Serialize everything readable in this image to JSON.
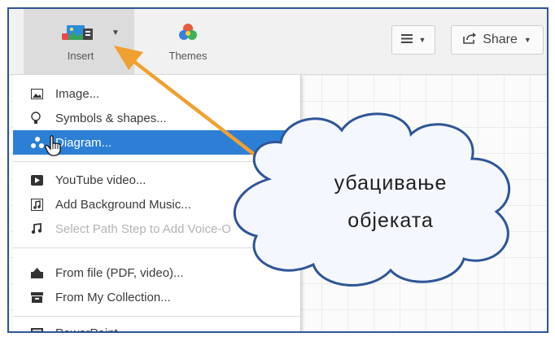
{
  "toolbar": {
    "insert_label": "Insert",
    "themes_label": "Themes",
    "share_label": "Share"
  },
  "menu": {
    "image": "Image...",
    "symbols": "Symbols & shapes...",
    "diagram": "Diagram...",
    "youtube": "YouTube video...",
    "music": "Add Background Music...",
    "voice": "Select Path Step to Add Voice-O",
    "file": "From file (PDF, video)...",
    "collection": "From My Collection...",
    "powerpoint": "PowerPoint..."
  },
  "callout": {
    "line1": "убацивање",
    "line2": "објеката"
  },
  "colors": {
    "frame_border": "#2f5597",
    "menu_highlight": "#2d7fd6",
    "arrow": "#f0a030",
    "cloud_fill": "#f4f7fd",
    "cloud_stroke": "#2f5597"
  },
  "icons": {
    "insert": "image-insert-icon",
    "themes": "themes-palette-icon",
    "hamburger": "hamburger-icon",
    "share": "share-icon",
    "image": "image-icon",
    "symbols": "lightbulb-icon",
    "diagram": "diagram-icon",
    "youtube": "play-icon",
    "music": "music-file-icon",
    "voice": "music-note-icon",
    "file": "upload-folder-icon",
    "collection": "inbox-icon",
    "powerpoint": "presentation-icon",
    "cursor": "hand-pointer-icon"
  }
}
